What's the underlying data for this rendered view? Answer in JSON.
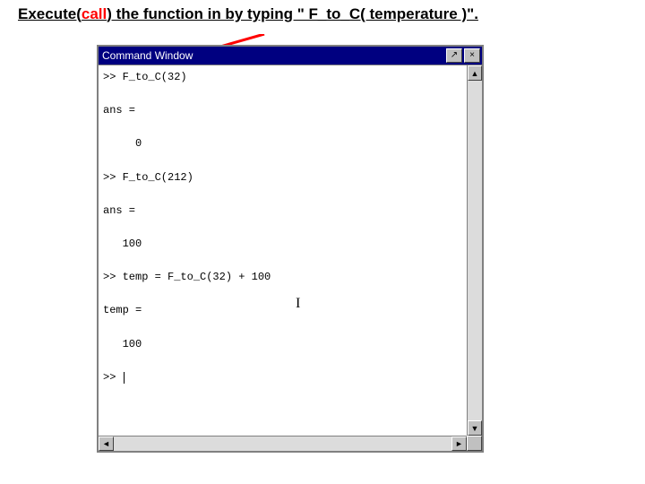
{
  "heading": {
    "pre": "Execute(",
    "redWord": "call",
    "post": ") the function in by typing \" F_to_C( temperature )\"."
  },
  "window": {
    "title": "Command Window",
    "dockBtn": "↗",
    "closeBtn": "×",
    "scroll": {
      "up": "▲",
      "down": "▼",
      "left": "◄",
      "right": "►"
    }
  },
  "console": {
    "lines": [
      ">> F_to_C(32)",
      "",
      "ans =",
      "",
      "     0",
      "",
      ">> F_to_C(212)",
      "",
      "ans =",
      "",
      "   100",
      "",
      ">> temp = F_to_C(32) + 100",
      "",
      "temp =",
      "",
      "   100",
      "",
      ">> "
    ]
  },
  "ibeam": "I"
}
